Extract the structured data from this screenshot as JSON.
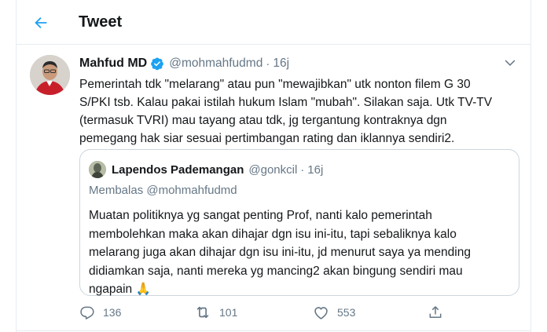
{
  "header": {
    "title": "Tweet",
    "back_icon": "arrow-left-icon"
  },
  "colors": {
    "accent": "#1da1f2",
    "text": "#14171a",
    "secondary": "#657786",
    "border": "#e6ecf0"
  },
  "tweet": {
    "author_name": "Mahfud MD",
    "verified": true,
    "handle": "@mohmahfudmd",
    "separator": "·",
    "time": "16j",
    "text_lines": [
      "Pemerintah tdk \"melarang\" atau pun \"mewajibkan\" utk nonton filem G 30",
      "S/PKI tsb. Kalau pakai istilah hukum Islam \"mubah\". Silakan saja. Utk TV-TV",
      "(termasuk TVRI) mau tayang atau tdk, jg tergantung kontraknya dgn",
      "pemegang hak siar sesuai pertimbangan rating dan iklannya sendiri2."
    ]
  },
  "quote": {
    "author_name": "Lapendos Pademangan",
    "handle": "@gonkcil",
    "separator": "·",
    "time": "16j",
    "reply_context": "Membalas @mohmahfudmd",
    "text_lines": [
      "Muatan politiknya yg sangat penting Prof, nanti kalo pemerintah",
      "membolehkan maka akan dihajar dgn isu ini-itu, tapi sebaliknya kalo",
      "melarang juga akan dihajar dgn isu ini-itu, jd menurut saya ya mending",
      "didiamkan saja, nanti mereka yg mancing2 akan bingung sendiri mau",
      "ngapain 🙏"
    ]
  },
  "actions": {
    "reply_count": "136",
    "retweet_count": "101",
    "like_count": "553"
  }
}
